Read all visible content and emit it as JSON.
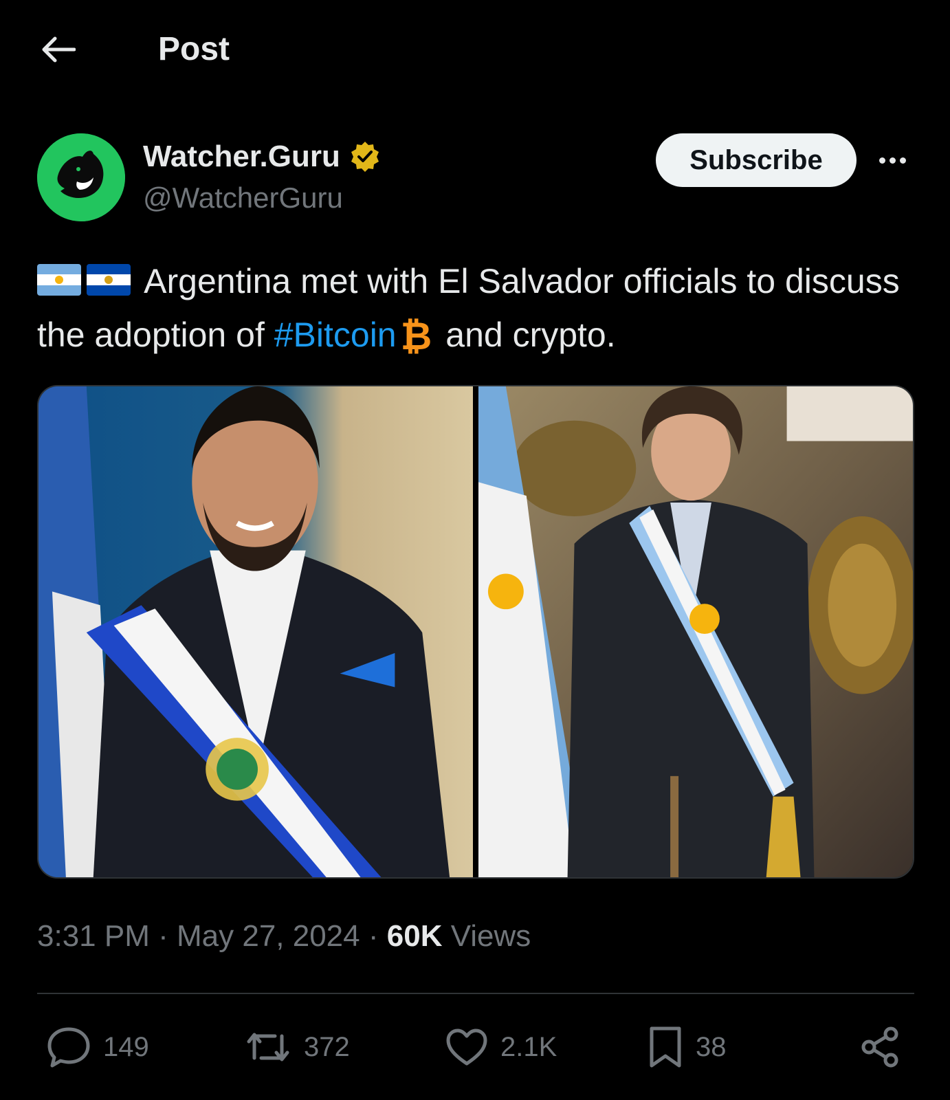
{
  "header": {
    "title": "Post",
    "back_icon": "arrow-left-icon"
  },
  "author": {
    "display_name": "Watcher.Guru",
    "handle": "@WatcherGuru",
    "verified_badge_color": "#e2b719",
    "avatar_color": "#22c55e",
    "subscribe_label": "Subscribe"
  },
  "tweet": {
    "text_part1": "Argentina met with El Salvador officials to discuss the adoption of ",
    "hashtag": "#Bitcoin",
    "btc_symbol": "₿",
    "text_part2": "and crypto.",
    "accent_color": "#1d9bf0"
  },
  "meta": {
    "time": "3:31 PM",
    "separator": "·",
    "date": "May 27, 2024",
    "views_count": "60K",
    "views_label": "Views"
  },
  "actions": {
    "replies": "149",
    "reposts": "372",
    "likes": "2.1K",
    "bookmarks": "38"
  }
}
